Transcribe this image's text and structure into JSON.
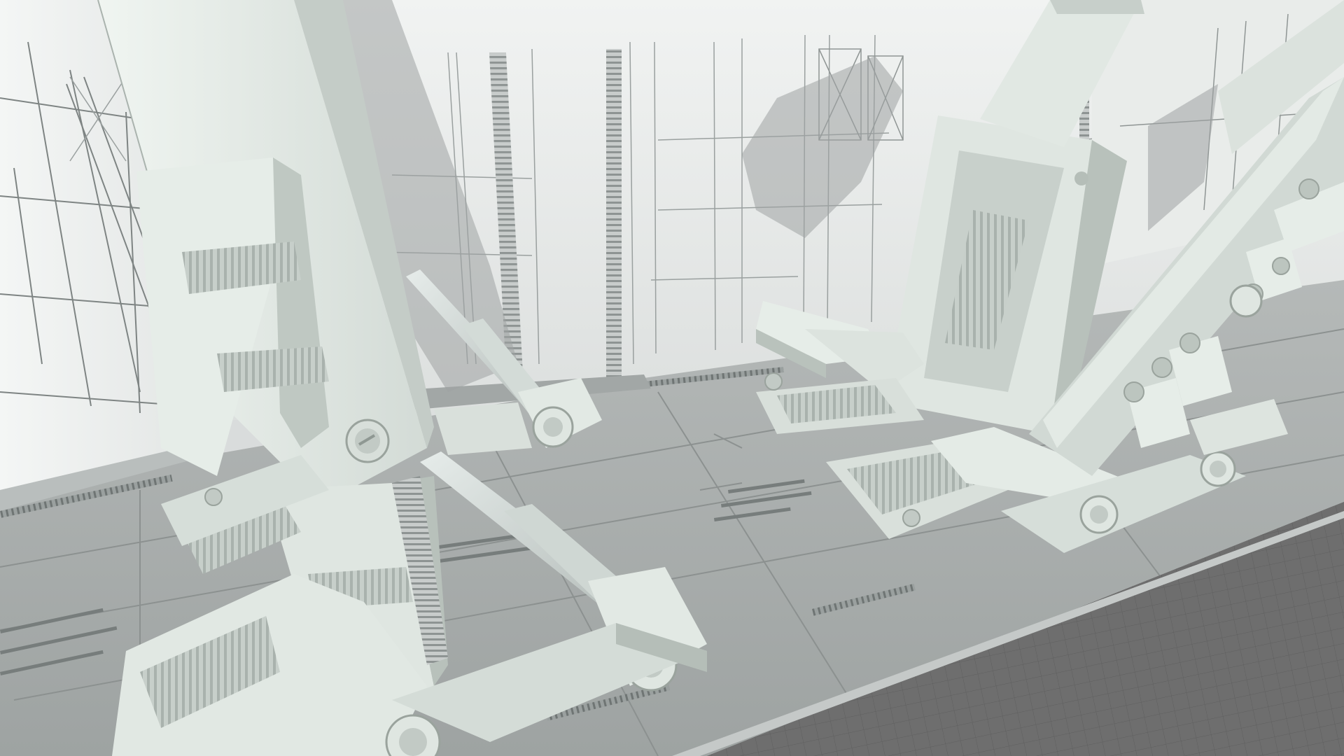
{
  "app": {
    "kind": "3d-model-viewport",
    "view": "perspective-shaded",
    "visible_text": []
  },
  "scene": {
    "model": "sci-fi-mecha-hangar-bay",
    "parts": [
      "back-wall-paneling",
      "left-wall-paneling",
      "hangar-floor",
      "ground-grid",
      "left-gantry-tower",
      "left-hydraulic-strut",
      "center-gantry-frame",
      "right-gantry-arm"
    ]
  },
  "colors": {
    "wall": "#e6e9e8",
    "wall_shadow": "#bfc3c2",
    "panel_line": "#8f9594",
    "floor": "#a5aaa9",
    "floor_dark": "#8c9190",
    "model_light": "#e4ebe6",
    "model_mid": "#c9d2cc",
    "model_dark": "#9da7a1",
    "grid_bg": "#6f6f6f",
    "grid_line": "#5d5d5d"
  }
}
